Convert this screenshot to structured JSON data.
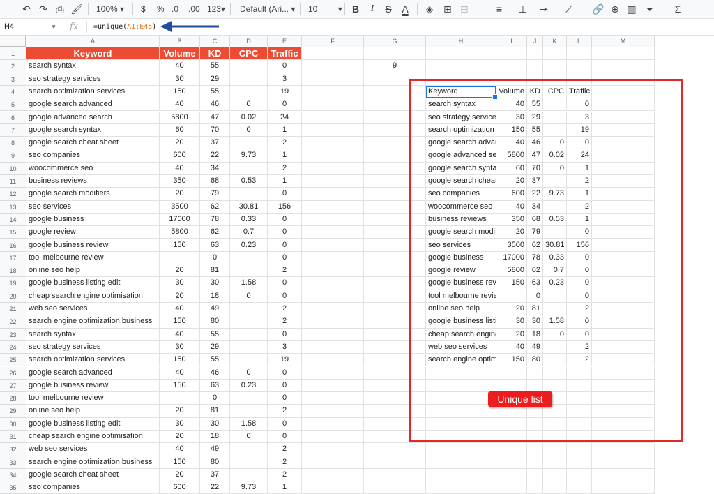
{
  "toolbar": {
    "zoom": "100%",
    "currency": "$",
    "percent": "%",
    "dec_decrease": ".0",
    "dec_increase": ".00",
    "more_formats": "123",
    "font": "Default (Ari...",
    "font_size": "10",
    "bold": "B",
    "italic": "I",
    "strike": "S",
    "text_color": "A"
  },
  "formula_bar": {
    "cell_ref": "H4",
    "fx": "fx",
    "formula_prefix": "=unique(",
    "formula_range": "A1:E45",
    "formula_suffix": ")"
  },
  "columns": [
    "A",
    "B",
    "C",
    "D",
    "E",
    "F",
    "G",
    "H",
    "I",
    "J",
    "K",
    "L",
    "M"
  ],
  "left_table": {
    "headers": [
      "Keyword",
      "Volume",
      "KD",
      "CPC",
      "Traffic"
    ],
    "rows": [
      [
        "search syntax",
        "40",
        "55",
        "",
        "0"
      ],
      [
        "seo strategy services",
        "30",
        "29",
        "",
        "3"
      ],
      [
        "search optimization services",
        "150",
        "55",
        "",
        "19"
      ],
      [
        "google search advanced",
        "40",
        "46",
        "0",
        "0"
      ],
      [
        "google advanced search",
        "5800",
        "47",
        "0.02",
        "24"
      ],
      [
        "google search syntax",
        "60",
        "70",
        "0",
        "1"
      ],
      [
        "google search cheat sheet",
        "20",
        "37",
        "",
        "2"
      ],
      [
        "seo companies",
        "600",
        "22",
        "9.73",
        "1"
      ],
      [
        "woocommerce seo",
        "40",
        "34",
        "",
        "2"
      ],
      [
        "business reviews",
        "350",
        "68",
        "0.53",
        "1"
      ],
      [
        "google search modifiers",
        "20",
        "79",
        "",
        "0"
      ],
      [
        "seo services",
        "3500",
        "62",
        "30.81",
        "156"
      ],
      [
        "google business",
        "17000",
        "78",
        "0.33",
        "0"
      ],
      [
        "google review",
        "5800",
        "62",
        "0.7",
        "0"
      ],
      [
        "google business review",
        "150",
        "63",
        "0.23",
        "0"
      ],
      [
        "tool melbourne review",
        "",
        "0",
        "",
        "0"
      ],
      [
        "online seo help",
        "20",
        "81",
        "",
        "2"
      ],
      [
        "google business listing edit",
        "30",
        "30",
        "1.58",
        "0"
      ],
      [
        "cheap search engine optimisation",
        "20",
        "18",
        "0",
        "0"
      ],
      [
        "web seo services",
        "40",
        "49",
        "",
        "2"
      ],
      [
        "search engine optimization business",
        "150",
        "80",
        "",
        "2"
      ],
      [
        "search syntax",
        "40",
        "55",
        "",
        "0"
      ],
      [
        "seo strategy services",
        "30",
        "29",
        "",
        "3"
      ],
      [
        "search optimization services",
        "150",
        "55",
        "",
        "19"
      ],
      [
        "google search advanced",
        "40",
        "46",
        "0",
        "0"
      ],
      [
        "google business review",
        "150",
        "63",
        "0.23",
        "0"
      ],
      [
        "tool melbourne review",
        "",
        "0",
        "",
        "0"
      ],
      [
        "online seo help",
        "20",
        "81",
        "",
        "2"
      ],
      [
        "google business listing edit",
        "30",
        "30",
        "1.58",
        "0"
      ],
      [
        "cheap search engine optimisation",
        "20",
        "18",
        "0",
        "0"
      ],
      [
        "web seo services",
        "40",
        "49",
        "",
        "2"
      ],
      [
        "search engine optimization business",
        "150",
        "80",
        "",
        "2"
      ],
      [
        "google search cheat sheet",
        "20",
        "37",
        "",
        "2"
      ],
      [
        "seo companies",
        "600",
        "22",
        "9.73",
        "1"
      ]
    ]
  },
  "g2_value": "9",
  "unique_table": {
    "headers": [
      "Keyword",
      "Volume",
      "KD",
      "CPC",
      "Traffic"
    ],
    "rows": [
      [
        "search syntax",
        "40",
        "55",
        "",
        "0"
      ],
      [
        "seo strategy services",
        "30",
        "29",
        "",
        "3"
      ],
      [
        "search optimization services",
        "150",
        "55",
        "",
        "19"
      ],
      [
        "google search advanced",
        "40",
        "46",
        "0",
        "0"
      ],
      [
        "google advanced search",
        "5800",
        "47",
        "0.02",
        "24"
      ],
      [
        "google search syntax",
        "60",
        "70",
        "0",
        "1"
      ],
      [
        "google search cheat sheet",
        "20",
        "37",
        "",
        "2"
      ],
      [
        "seo companies",
        "600",
        "22",
        "9.73",
        "1"
      ],
      [
        "woocommerce seo",
        "40",
        "34",
        "",
        "2"
      ],
      [
        "business reviews",
        "350",
        "68",
        "0.53",
        "1"
      ],
      [
        "google search modifiers",
        "20",
        "79",
        "",
        "0"
      ],
      [
        "seo services",
        "3500",
        "62",
        "30.81",
        "156"
      ],
      [
        "google business",
        "17000",
        "78",
        "0.33",
        "0"
      ],
      [
        "google review",
        "5800",
        "62",
        "0.7",
        "0"
      ],
      [
        "google business review",
        "150",
        "63",
        "0.23",
        "0"
      ],
      [
        "tool melbourne review",
        "",
        "0",
        "",
        "0"
      ],
      [
        "online seo help",
        "20",
        "81",
        "",
        "2"
      ],
      [
        "google business listing edit",
        "30",
        "30",
        "1.58",
        "0"
      ],
      [
        "cheap search engine optimisation",
        "20",
        "18",
        "0",
        "0"
      ],
      [
        "web seo services",
        "40",
        "49",
        "",
        "2"
      ],
      [
        "search engine optimization business",
        "150",
        "80",
        "",
        "2"
      ]
    ]
  },
  "annotation": {
    "label": "Unique list",
    "box_color": "#e3282a",
    "arrow_color": "#1f4e9c"
  },
  "colors": {
    "header_fill": "#ec4b34",
    "selection": "#1a73e8"
  }
}
